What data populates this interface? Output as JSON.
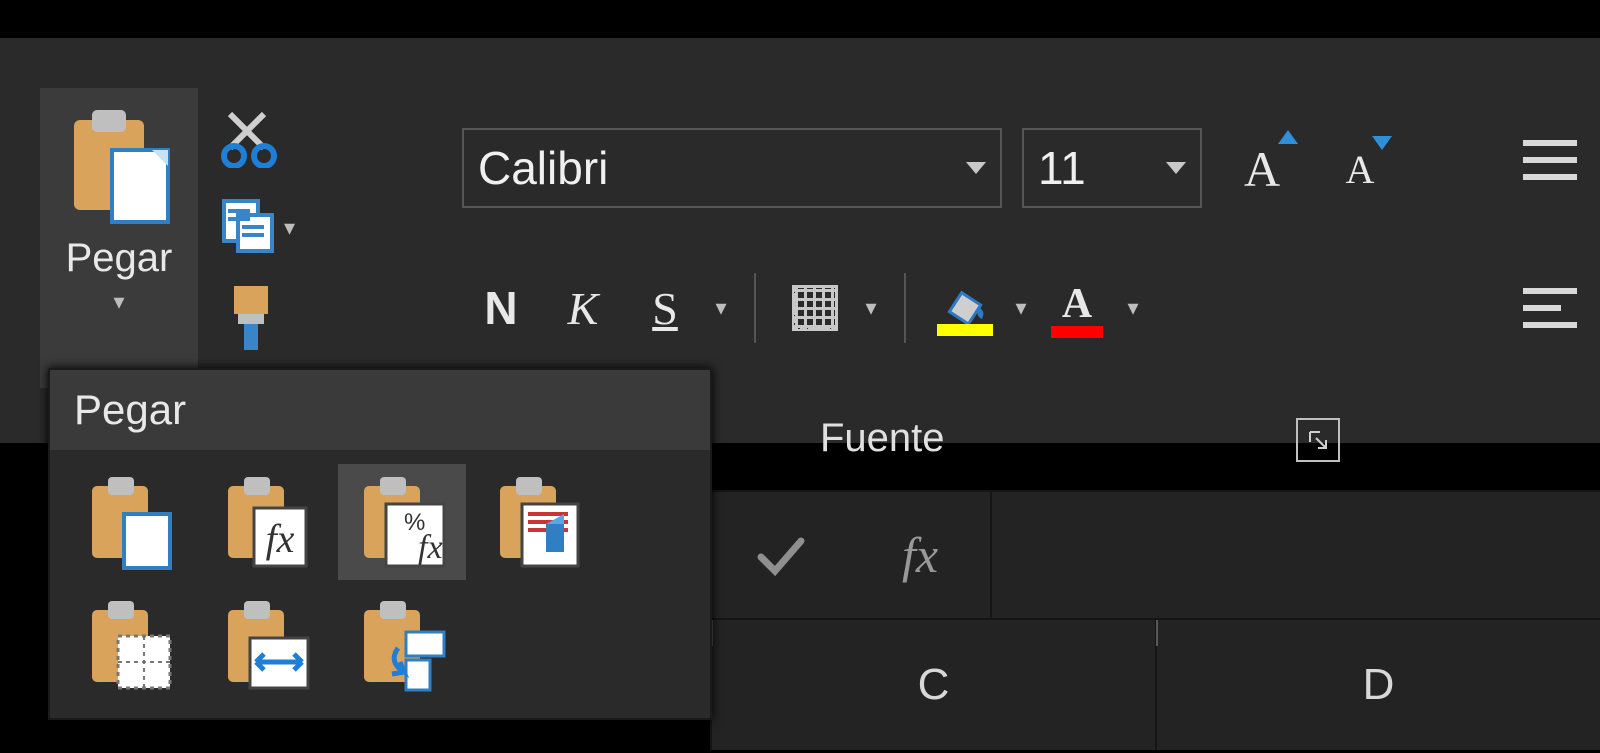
{
  "clipboard": {
    "paste_label": "Pegar"
  },
  "font": {
    "family": "Calibri",
    "size": "11",
    "bold": "N",
    "italic": "K",
    "underline": "S",
    "group_label": "Fuente",
    "fill_color": "#ffff00",
    "font_color": "#ff0000"
  },
  "paste_menu": {
    "header": "Pegar",
    "options": [
      {
        "name": "paste"
      },
      {
        "name": "paste-formulas"
      },
      {
        "name": "paste-formulas-number-format"
      },
      {
        "name": "paste-keep-source-formatting"
      },
      {
        "name": "paste-no-borders"
      },
      {
        "name": "paste-keep-column-widths"
      },
      {
        "name": "paste-transpose"
      }
    ]
  },
  "formula_bar": {
    "fx": "fx"
  },
  "columns": [
    "C",
    "D"
  ]
}
